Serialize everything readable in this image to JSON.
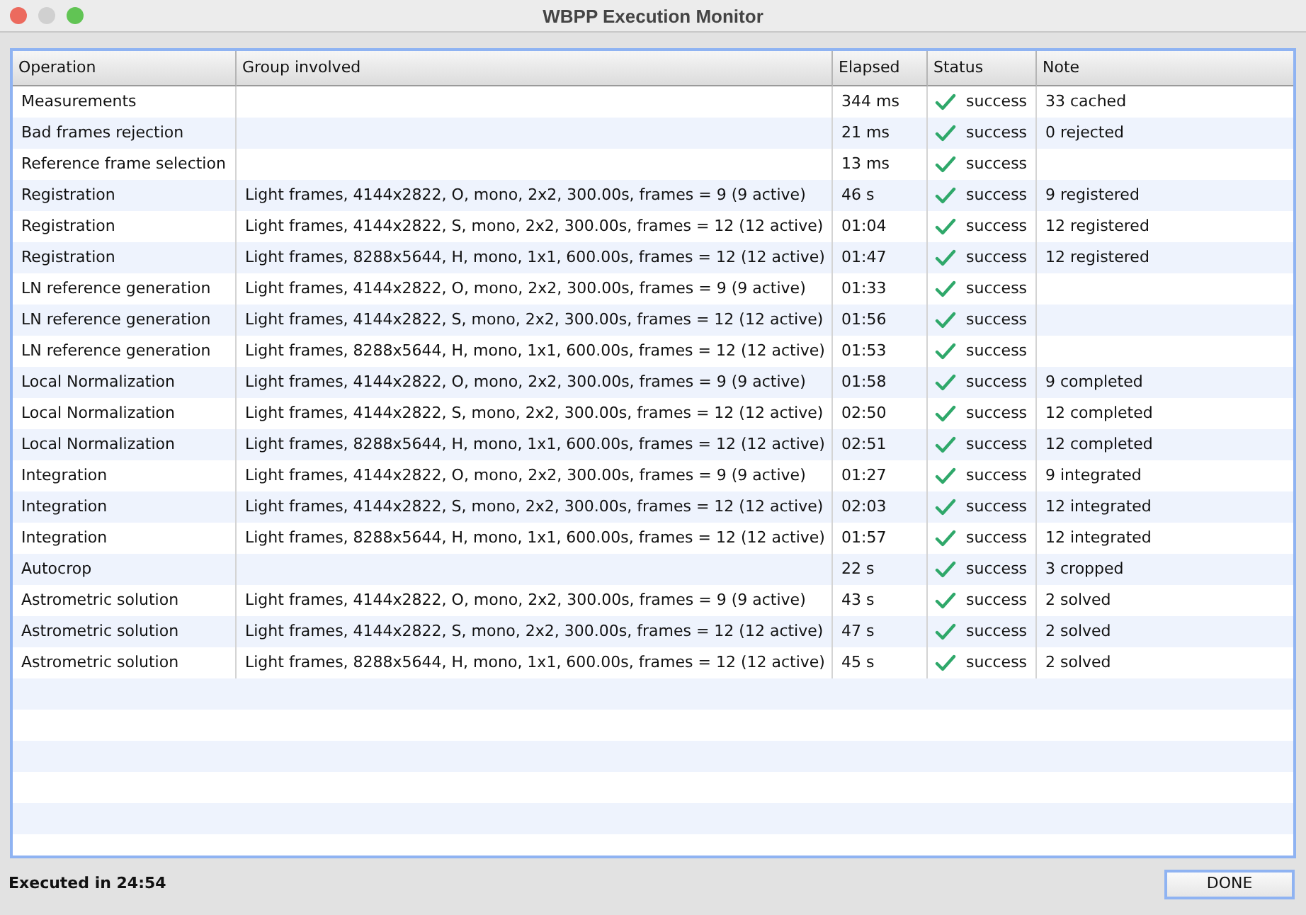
{
  "window": {
    "title": "WBPP Execution Monitor"
  },
  "table": {
    "columns": [
      "Operation",
      "Group involved",
      "Elapsed",
      "Status",
      "Note"
    ],
    "rows": [
      {
        "operation": "Measurements",
        "group": "",
        "elapsed": "344 ms",
        "status": {
          "kind": "success",
          "label": "success"
        },
        "note": "33 cached"
      },
      {
        "operation": "Bad frames rejection",
        "group": "",
        "elapsed": "21 ms",
        "status": {
          "kind": "success",
          "label": "success"
        },
        "note": "0 rejected"
      },
      {
        "operation": "Reference frame selection",
        "group": "",
        "elapsed": "13 ms",
        "status": {
          "kind": "success",
          "label": "success"
        },
        "note": ""
      },
      {
        "operation": "Registration",
        "group": "Light frames, 4144x2822, O, mono, 2x2, 300.00s, frames = 9 (9 active)",
        "elapsed": "46 s",
        "status": {
          "kind": "success",
          "label": "success"
        },
        "note": "9 registered"
      },
      {
        "operation": "Registration",
        "group": "Light frames, 4144x2822, S, mono, 2x2, 300.00s, frames = 12 (12 active)",
        "elapsed": "01:04",
        "status": {
          "kind": "success",
          "label": "success"
        },
        "note": "12 registered"
      },
      {
        "operation": "Registration",
        "group": "Light frames, 8288x5644, H, mono, 1x1, 600.00s, frames = 12 (12 active)",
        "elapsed": "01:47",
        "status": {
          "kind": "success",
          "label": "success"
        },
        "note": "12 registered"
      },
      {
        "operation": "LN reference generation",
        "group": "Light frames, 4144x2822, O, mono, 2x2, 300.00s, frames = 9 (9 active)",
        "elapsed": "01:33",
        "status": {
          "kind": "success",
          "label": "success"
        },
        "note": ""
      },
      {
        "operation": "LN reference generation",
        "group": "Light frames, 4144x2822, S, mono, 2x2, 300.00s, frames = 12 (12 active)",
        "elapsed": "01:56",
        "status": {
          "kind": "success",
          "label": "success"
        },
        "note": ""
      },
      {
        "operation": "LN reference generation",
        "group": "Light frames, 8288x5644, H, mono, 1x1, 600.00s, frames = 12 (12 active)",
        "elapsed": "01:53",
        "status": {
          "kind": "success",
          "label": "success"
        },
        "note": ""
      },
      {
        "operation": "Local Normalization",
        "group": "Light frames, 4144x2822, O, mono, 2x2, 300.00s, frames = 9 (9 active)",
        "elapsed": "01:58",
        "status": {
          "kind": "success",
          "label": "success"
        },
        "note": "9 completed"
      },
      {
        "operation": "Local Normalization",
        "group": "Light frames, 4144x2822, S, mono, 2x2, 300.00s, frames = 12 (12 active)",
        "elapsed": "02:50",
        "status": {
          "kind": "success",
          "label": "success"
        },
        "note": "12 completed"
      },
      {
        "operation": "Local Normalization",
        "group": "Light frames, 8288x5644, H, mono, 1x1, 600.00s, frames = 12 (12 active)",
        "elapsed": "02:51",
        "status": {
          "kind": "success",
          "label": "success"
        },
        "note": "12 completed"
      },
      {
        "operation": "Integration",
        "group": "Light frames, 4144x2822, O, mono, 2x2, 300.00s, frames = 9 (9 active)",
        "elapsed": "01:27",
        "status": {
          "kind": "success",
          "label": "success"
        },
        "note": "9 integrated"
      },
      {
        "operation": "Integration",
        "group": "Light frames, 4144x2822, S, mono, 2x2, 300.00s, frames = 12 (12 active)",
        "elapsed": "02:03",
        "status": {
          "kind": "success",
          "label": "success"
        },
        "note": "12 integrated"
      },
      {
        "operation": "Integration",
        "group": "Light frames, 8288x5644, H, mono, 1x1, 600.00s, frames = 12 (12 active)",
        "elapsed": "01:57",
        "status": {
          "kind": "success",
          "label": "success"
        },
        "note": "12 integrated"
      },
      {
        "operation": "Autocrop",
        "group": "",
        "elapsed": "22 s",
        "status": {
          "kind": "success",
          "label": "success"
        },
        "note": "3 cropped"
      },
      {
        "operation": "Astrometric solution",
        "group": "Light frames, 4144x2822, O, mono, 2x2, 300.00s, frames = 9 (9 active)",
        "elapsed": "43 s",
        "status": {
          "kind": "success",
          "label": "success"
        },
        "note": "2 solved"
      },
      {
        "operation": "Astrometric solution",
        "group": "Light frames, 4144x2822, S, mono, 2x2, 300.00s, frames = 12 (12 active)",
        "elapsed": "47 s",
        "status": {
          "kind": "success",
          "label": "success"
        },
        "note": "2 solved"
      },
      {
        "operation": "Astrometric solution",
        "group": "Light frames, 8288x5644, H, mono, 1x1, 600.00s, frames = 12 (12 active)",
        "elapsed": "45 s",
        "status": {
          "kind": "success",
          "label": "success"
        },
        "note": "2 solved"
      }
    ]
  },
  "footer": {
    "summary": "Executed in 24:54",
    "button": "DONE"
  }
}
